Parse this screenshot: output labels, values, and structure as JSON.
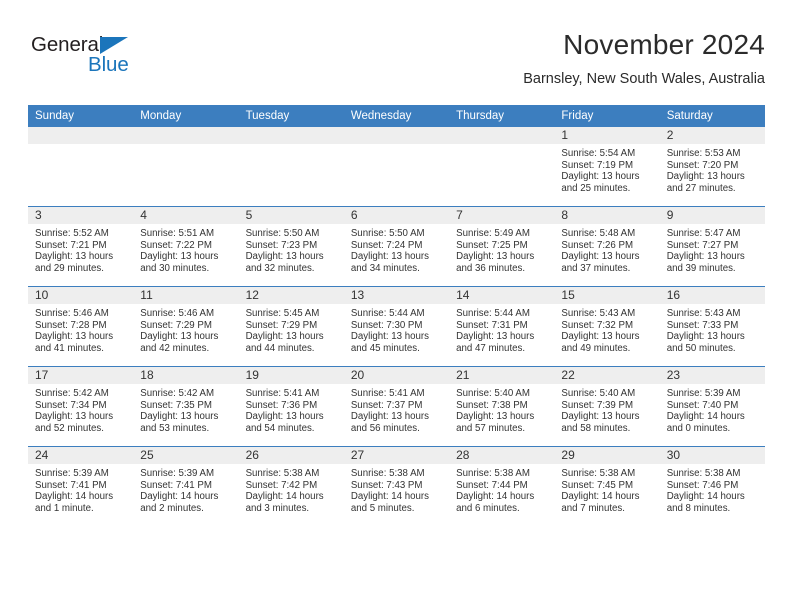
{
  "brand": {
    "name_top": "General",
    "name_bottom": "Blue",
    "triangle_color": "#1b75bb"
  },
  "header": {
    "title": "November 2024",
    "subtitle": "Barnsley, New South Wales, Australia"
  },
  "theme": {
    "header_blue": "#3c7ebf",
    "band_gray": "#eeeeee",
    "text": "#333333"
  },
  "weekday_headers": [
    "Sunday",
    "Monday",
    "Tuesday",
    "Wednesday",
    "Thursday",
    "Friday",
    "Saturday"
  ],
  "weeks": [
    [
      {
        "day": "",
        "empty": true
      },
      {
        "day": "",
        "empty": true
      },
      {
        "day": "",
        "empty": true
      },
      {
        "day": "",
        "empty": true
      },
      {
        "day": "",
        "empty": true
      },
      {
        "day": "1",
        "sunrise": "Sunrise: 5:54 AM",
        "sunset": "Sunset: 7:19 PM",
        "daylight": "Daylight: 13 hours and 25 minutes."
      },
      {
        "day": "2",
        "sunrise": "Sunrise: 5:53 AM",
        "sunset": "Sunset: 7:20 PM",
        "daylight": "Daylight: 13 hours and 27 minutes."
      }
    ],
    [
      {
        "day": "3",
        "sunrise": "Sunrise: 5:52 AM",
        "sunset": "Sunset: 7:21 PM",
        "daylight": "Daylight: 13 hours and 29 minutes."
      },
      {
        "day": "4",
        "sunrise": "Sunrise: 5:51 AM",
        "sunset": "Sunset: 7:22 PM",
        "daylight": "Daylight: 13 hours and 30 minutes."
      },
      {
        "day": "5",
        "sunrise": "Sunrise: 5:50 AM",
        "sunset": "Sunset: 7:23 PM",
        "daylight": "Daylight: 13 hours and 32 minutes."
      },
      {
        "day": "6",
        "sunrise": "Sunrise: 5:50 AM",
        "sunset": "Sunset: 7:24 PM",
        "daylight": "Daylight: 13 hours and 34 minutes."
      },
      {
        "day": "7",
        "sunrise": "Sunrise: 5:49 AM",
        "sunset": "Sunset: 7:25 PM",
        "daylight": "Daylight: 13 hours and 36 minutes."
      },
      {
        "day": "8",
        "sunrise": "Sunrise: 5:48 AM",
        "sunset": "Sunset: 7:26 PM",
        "daylight": "Daylight: 13 hours and 37 minutes."
      },
      {
        "day": "9",
        "sunrise": "Sunrise: 5:47 AM",
        "sunset": "Sunset: 7:27 PM",
        "daylight": "Daylight: 13 hours and 39 minutes."
      }
    ],
    [
      {
        "day": "10",
        "sunrise": "Sunrise: 5:46 AM",
        "sunset": "Sunset: 7:28 PM",
        "daylight": "Daylight: 13 hours and 41 minutes."
      },
      {
        "day": "11",
        "sunrise": "Sunrise: 5:46 AM",
        "sunset": "Sunset: 7:29 PM",
        "daylight": "Daylight: 13 hours and 42 minutes."
      },
      {
        "day": "12",
        "sunrise": "Sunrise: 5:45 AM",
        "sunset": "Sunset: 7:29 PM",
        "daylight": "Daylight: 13 hours and 44 minutes."
      },
      {
        "day": "13",
        "sunrise": "Sunrise: 5:44 AM",
        "sunset": "Sunset: 7:30 PM",
        "daylight": "Daylight: 13 hours and 45 minutes."
      },
      {
        "day": "14",
        "sunrise": "Sunrise: 5:44 AM",
        "sunset": "Sunset: 7:31 PM",
        "daylight": "Daylight: 13 hours and 47 minutes."
      },
      {
        "day": "15",
        "sunrise": "Sunrise: 5:43 AM",
        "sunset": "Sunset: 7:32 PM",
        "daylight": "Daylight: 13 hours and 49 minutes."
      },
      {
        "day": "16",
        "sunrise": "Sunrise: 5:43 AM",
        "sunset": "Sunset: 7:33 PM",
        "daylight": "Daylight: 13 hours and 50 minutes."
      }
    ],
    [
      {
        "day": "17",
        "sunrise": "Sunrise: 5:42 AM",
        "sunset": "Sunset: 7:34 PM",
        "daylight": "Daylight: 13 hours and 52 minutes."
      },
      {
        "day": "18",
        "sunrise": "Sunrise: 5:42 AM",
        "sunset": "Sunset: 7:35 PM",
        "daylight": "Daylight: 13 hours and 53 minutes."
      },
      {
        "day": "19",
        "sunrise": "Sunrise: 5:41 AM",
        "sunset": "Sunset: 7:36 PM",
        "daylight": "Daylight: 13 hours and 54 minutes."
      },
      {
        "day": "20",
        "sunrise": "Sunrise: 5:41 AM",
        "sunset": "Sunset: 7:37 PM",
        "daylight": "Daylight: 13 hours and 56 minutes."
      },
      {
        "day": "21",
        "sunrise": "Sunrise: 5:40 AM",
        "sunset": "Sunset: 7:38 PM",
        "daylight": "Daylight: 13 hours and 57 minutes."
      },
      {
        "day": "22",
        "sunrise": "Sunrise: 5:40 AM",
        "sunset": "Sunset: 7:39 PM",
        "daylight": "Daylight: 13 hours and 58 minutes."
      },
      {
        "day": "23",
        "sunrise": "Sunrise: 5:39 AM",
        "sunset": "Sunset: 7:40 PM",
        "daylight": "Daylight: 14 hours and 0 minutes."
      }
    ],
    [
      {
        "day": "24",
        "sunrise": "Sunrise: 5:39 AM",
        "sunset": "Sunset: 7:41 PM",
        "daylight": "Daylight: 14 hours and 1 minute."
      },
      {
        "day": "25",
        "sunrise": "Sunrise: 5:39 AM",
        "sunset": "Sunset: 7:41 PM",
        "daylight": "Daylight: 14 hours and 2 minutes."
      },
      {
        "day": "26",
        "sunrise": "Sunrise: 5:38 AM",
        "sunset": "Sunset: 7:42 PM",
        "daylight": "Daylight: 14 hours and 3 minutes."
      },
      {
        "day": "27",
        "sunrise": "Sunrise: 5:38 AM",
        "sunset": "Sunset: 7:43 PM",
        "daylight": "Daylight: 14 hours and 5 minutes."
      },
      {
        "day": "28",
        "sunrise": "Sunrise: 5:38 AM",
        "sunset": "Sunset: 7:44 PM",
        "daylight": "Daylight: 14 hours and 6 minutes."
      },
      {
        "day": "29",
        "sunrise": "Sunrise: 5:38 AM",
        "sunset": "Sunset: 7:45 PM",
        "daylight": "Daylight: 14 hours and 7 minutes."
      },
      {
        "day": "30",
        "sunrise": "Sunrise: 5:38 AM",
        "sunset": "Sunset: 7:46 PM",
        "daylight": "Daylight: 14 hours and 8 minutes."
      }
    ]
  ]
}
